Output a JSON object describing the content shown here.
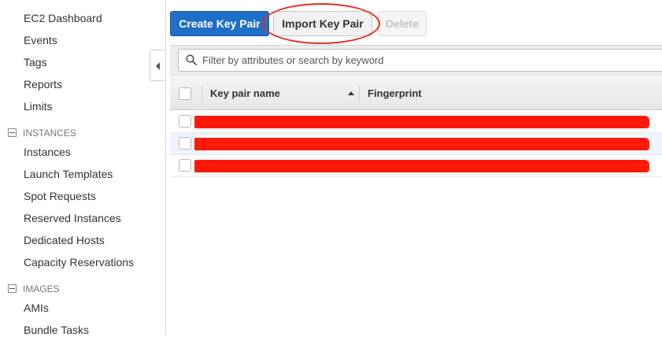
{
  "sidebar": {
    "items_top": [
      "EC2 Dashboard",
      "Events",
      "Tags",
      "Reports",
      "Limits"
    ],
    "sections": [
      {
        "title": "INSTANCES",
        "items": [
          "Instances",
          "Launch Templates",
          "Spot Requests",
          "Reserved Instances",
          "Dedicated Hosts",
          "Capacity Reservations"
        ]
      },
      {
        "title": "IMAGES",
        "items": [
          "AMIs",
          "Bundle Tasks"
        ]
      }
    ]
  },
  "toolbar": {
    "create_label": "Create Key Pair",
    "import_label": "Import Key Pair",
    "delete_label": "Delete"
  },
  "filter": {
    "placeholder": "Filter by attributes or search by keyword"
  },
  "table": {
    "columns": [
      "Key pair name",
      "Fingerprint"
    ],
    "sort_direction": "ascending",
    "rows": [
      {
        "redacted": true
      },
      {
        "redacted": true
      },
      {
        "redacted": true,
        "partial_visible": "y"
      }
    ]
  },
  "colors": {
    "primary_button": "#1f6fc9",
    "redaction": "#ff1a0a",
    "annotation_ring": "#e53020",
    "selected_row": "#eef5fc"
  },
  "icons": [
    "search-icon",
    "collapse-arrow-icon",
    "sort-ascending-icon",
    "collapse-section-icon"
  ]
}
